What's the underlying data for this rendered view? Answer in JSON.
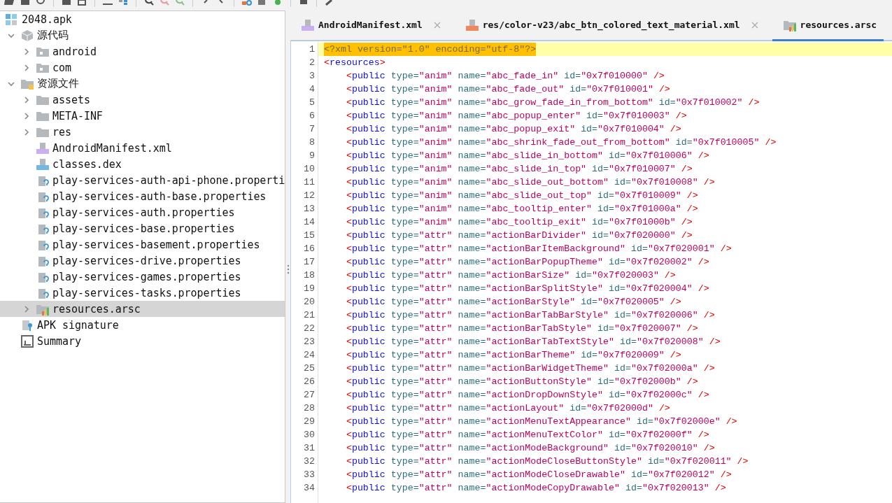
{
  "tree": {
    "label": "2048.apk",
    "kind": "apk",
    "selected": false,
    "children": [
      {
        "label": "源代码",
        "kind": "package",
        "selected": false,
        "expanded": true,
        "children": [
          {
            "label": "android",
            "kind": "pkgfolder",
            "selected": false,
            "expanded": false
          },
          {
            "label": "com",
            "kind": "pkgfolder",
            "selected": false,
            "expanded": false
          }
        ]
      },
      {
        "label": "资源文件",
        "kind": "resfolder",
        "selected": false,
        "expanded": true,
        "children": [
          {
            "label": "assets",
            "kind": "folder",
            "selected": false,
            "expanded": false
          },
          {
            "label": "META-INF",
            "kind": "folder",
            "selected": false,
            "expanded": false
          },
          {
            "label": "res",
            "kind": "folder",
            "selected": false,
            "expanded": false
          },
          {
            "label": "AndroidManifest.xml",
            "kind": "manifest",
            "selected": false
          },
          {
            "label": "classes.dex",
            "kind": "dex",
            "selected": false
          },
          {
            "label": "play-services-auth-api-phone.properti",
            "kind": "properties",
            "selected": false
          },
          {
            "label": "play-services-auth-base.properties",
            "kind": "properties",
            "selected": false
          },
          {
            "label": "play-services-auth.properties",
            "kind": "properties",
            "selected": false
          },
          {
            "label": "play-services-base.properties",
            "kind": "properties",
            "selected": false
          },
          {
            "label": "play-services-basement.properties",
            "kind": "properties",
            "selected": false
          },
          {
            "label": "play-services-drive.properties",
            "kind": "properties",
            "selected": false
          },
          {
            "label": "play-services-games.properties",
            "kind": "properties",
            "selected": false
          },
          {
            "label": "play-services-tasks.properties",
            "kind": "properties",
            "selected": false
          },
          {
            "label": "resources.arsc",
            "kind": "arsc",
            "selected": true,
            "expanded": false
          }
        ]
      },
      {
        "label": "APK signature",
        "kind": "signature",
        "selected": false
      },
      {
        "label": "Summary",
        "kind": "summary",
        "selected": false
      }
    ]
  },
  "tabs": [
    {
      "label": "AndroidManifest.xml",
      "kind": "manifest",
      "selected": false
    },
    {
      "label": "res/color-v23/abc_btn_colored_text_material.xml",
      "kind": "xml",
      "selected": false
    },
    {
      "label": "resources.arsc",
      "kind": "arsc",
      "selected": true
    }
  ],
  "code_lines": [
    {
      "number": "1",
      "kind": "declaration",
      "current": true,
      "text": "<?xml version=\"1.0\" encoding=\"utf-8\"?>"
    },
    {
      "number": "2",
      "kind": "markup",
      "current": false,
      "text": "<resources>"
    },
    {
      "number": "3",
      "kind": "markup",
      "current": false,
      "text": "    <public type=\"anim\" name=\"abc_fade_in\" id=\"0x7f010000\" />"
    },
    {
      "number": "4",
      "kind": "markup",
      "current": false,
      "text": "    <public type=\"anim\" name=\"abc_fade_out\" id=\"0x7f010001\" />"
    },
    {
      "number": "5",
      "kind": "markup",
      "current": false,
      "text": "    <public type=\"anim\" name=\"abc_grow_fade_in_from_bottom\" id=\"0x7f010002\" />"
    },
    {
      "number": "6",
      "kind": "markup",
      "current": false,
      "text": "    <public type=\"anim\" name=\"abc_popup_enter\" id=\"0x7f010003\" />"
    },
    {
      "number": "7",
      "kind": "markup",
      "current": false,
      "text": "    <public type=\"anim\" name=\"abc_popup_exit\" id=\"0x7f010004\" />"
    },
    {
      "number": "8",
      "kind": "markup",
      "current": false,
      "text": "    <public type=\"anim\" name=\"abc_shrink_fade_out_from_bottom\" id=\"0x7f010005\" />"
    },
    {
      "number": "9",
      "kind": "markup",
      "current": false,
      "text": "    <public type=\"anim\" name=\"abc_slide_in_bottom\" id=\"0x7f010006\" />"
    },
    {
      "number": "10",
      "kind": "markup",
      "current": false,
      "text": "    <public type=\"anim\" name=\"abc_slide_in_top\" id=\"0x7f010007\" />"
    },
    {
      "number": "11",
      "kind": "markup",
      "current": false,
      "text": "    <public type=\"anim\" name=\"abc_slide_out_bottom\" id=\"0x7f010008\" />"
    },
    {
      "number": "12",
      "kind": "markup",
      "current": false,
      "text": "    <public type=\"anim\" name=\"abc_slide_out_top\" id=\"0x7f010009\" />"
    },
    {
      "number": "13",
      "kind": "markup",
      "current": false,
      "text": "    <public type=\"anim\" name=\"abc_tooltip_enter\" id=\"0x7f01000a\" />"
    },
    {
      "number": "14",
      "kind": "markup",
      "current": false,
      "text": "    <public type=\"anim\" name=\"abc_tooltip_exit\" id=\"0x7f01000b\" />"
    },
    {
      "number": "15",
      "kind": "markup",
      "current": false,
      "text": "    <public type=\"attr\" name=\"actionBarDivider\" id=\"0x7f020000\" />"
    },
    {
      "number": "16",
      "kind": "markup",
      "current": false,
      "text": "    <public type=\"attr\" name=\"actionBarItemBackground\" id=\"0x7f020001\" />"
    },
    {
      "number": "17",
      "kind": "markup",
      "current": false,
      "text": "    <public type=\"attr\" name=\"actionBarPopupTheme\" id=\"0x7f020002\" />"
    },
    {
      "number": "18",
      "kind": "markup",
      "current": false,
      "text": "    <public type=\"attr\" name=\"actionBarSize\" id=\"0x7f020003\" />"
    },
    {
      "number": "19",
      "kind": "markup",
      "current": false,
      "text": "    <public type=\"attr\" name=\"actionBarSplitStyle\" id=\"0x7f020004\" />"
    },
    {
      "number": "20",
      "kind": "markup",
      "current": false,
      "text": "    <public type=\"attr\" name=\"actionBarStyle\" id=\"0x7f020005\" />"
    },
    {
      "number": "21",
      "kind": "markup",
      "current": false,
      "text": "    <public type=\"attr\" name=\"actionBarTabBarStyle\" id=\"0x7f020006\" />"
    },
    {
      "number": "22",
      "kind": "markup",
      "current": false,
      "text": "    <public type=\"attr\" name=\"actionBarTabStyle\" id=\"0x7f020007\" />"
    },
    {
      "number": "23",
      "kind": "markup",
      "current": false,
      "text": "    <public type=\"attr\" name=\"actionBarTabTextStyle\" id=\"0x7f020008\" />"
    },
    {
      "number": "24",
      "kind": "markup",
      "current": false,
      "text": "    <public type=\"attr\" name=\"actionBarTheme\" id=\"0x7f020009\" />"
    },
    {
      "number": "25",
      "kind": "markup",
      "current": false,
      "text": "    <public type=\"attr\" name=\"actionBarWidgetTheme\" id=\"0x7f02000a\" />"
    },
    {
      "number": "26",
      "kind": "markup",
      "current": false,
      "text": "    <public type=\"attr\" name=\"actionButtonStyle\" id=\"0x7f02000b\" />"
    },
    {
      "number": "27",
      "kind": "markup",
      "current": false,
      "text": "    <public type=\"attr\" name=\"actionDropDownStyle\" id=\"0x7f02000c\" />"
    },
    {
      "number": "28",
      "kind": "markup",
      "current": false,
      "text": "    <public type=\"attr\" name=\"actionLayout\" id=\"0x7f02000d\" />"
    },
    {
      "number": "29",
      "kind": "markup",
      "current": false,
      "text": "    <public type=\"attr\" name=\"actionMenuTextAppearance\" id=\"0x7f02000e\" />"
    },
    {
      "number": "30",
      "kind": "markup",
      "current": false,
      "text": "    <public type=\"attr\" name=\"actionMenuTextColor\" id=\"0x7f02000f\" />"
    },
    {
      "number": "31",
      "kind": "markup",
      "current": false,
      "text": "    <public type=\"attr\" name=\"actionModeBackground\" id=\"0x7f020010\" />"
    },
    {
      "number": "32",
      "kind": "markup",
      "current": false,
      "text": "    <public type=\"attr\" name=\"actionModeCloseButtonStyle\" id=\"0x7f020011\" />"
    },
    {
      "number": "33",
      "kind": "markup",
      "current": false,
      "text": "    <public type=\"attr\" name=\"actionModeCloseDrawable\" id=\"0x7f020012\" />"
    },
    {
      "number": "34",
      "kind": "markup",
      "current": false,
      "text": "    <public type=\"attr\" name=\"actionModeCopyDrawable\" id=\"0x7f020013\" />"
    }
  ]
}
